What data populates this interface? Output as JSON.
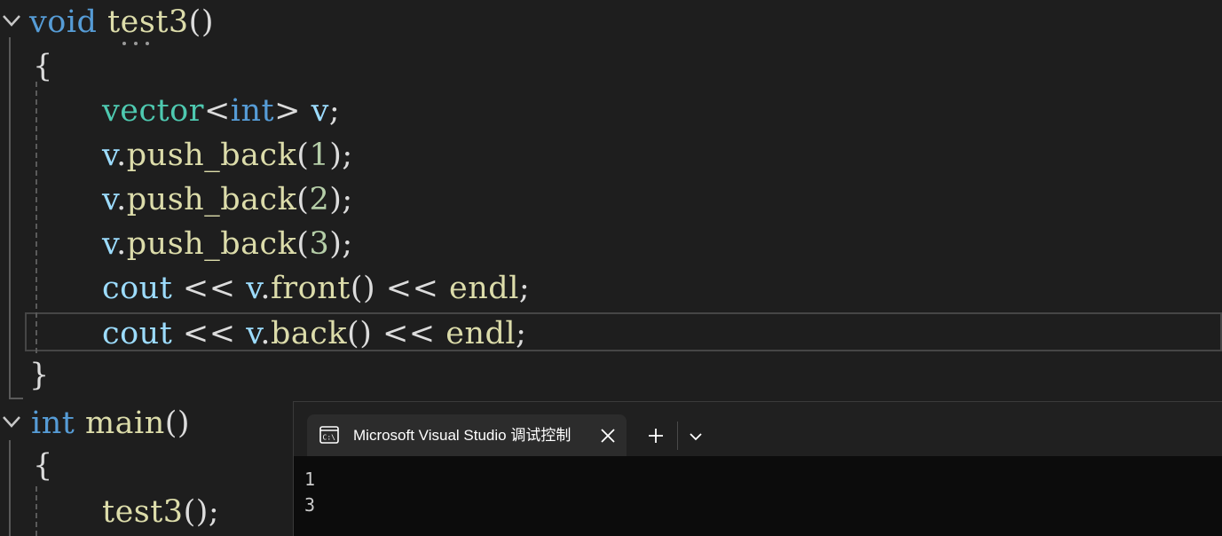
{
  "editor": {
    "lines": [
      [
        {
          "t": "void",
          "c": "kw"
        },
        {
          "t": " "
        },
        {
          "t": "test3",
          "c": "fn"
        },
        {
          "t": "()",
          "c": "pun"
        }
      ],
      [
        {
          "t": "{",
          "c": "pun"
        }
      ],
      [],
      [
        {
          "t": "vector",
          "c": "typ"
        },
        {
          "t": "<",
          "c": "pun"
        },
        {
          "t": "int",
          "c": "kw"
        },
        {
          "t": "> ",
          "c": "pun"
        },
        {
          "t": "v",
          "c": "var"
        },
        {
          "t": ";",
          "c": "pun"
        }
      ],
      [
        {
          "t": "v",
          "c": "var"
        },
        {
          "t": ".",
          "c": "pun"
        },
        {
          "t": "push_back",
          "c": "fn"
        },
        {
          "t": "(",
          "c": "pun"
        },
        {
          "t": "1",
          "c": "num"
        },
        {
          "t": ");",
          "c": "pun"
        }
      ],
      [
        {
          "t": "v",
          "c": "var"
        },
        {
          "t": ".",
          "c": "pun"
        },
        {
          "t": "push_back",
          "c": "fn"
        },
        {
          "t": "(",
          "c": "pun"
        },
        {
          "t": "2",
          "c": "num"
        },
        {
          "t": ");",
          "c": "pun"
        }
      ],
      [
        {
          "t": "v",
          "c": "var"
        },
        {
          "t": ".",
          "c": "pun"
        },
        {
          "t": "push_back",
          "c": "fn"
        },
        {
          "t": "(",
          "c": "pun"
        },
        {
          "t": "3",
          "c": "num"
        },
        {
          "t": ");",
          "c": "pun"
        }
      ],
      [
        {
          "t": "cout",
          "c": "var"
        },
        {
          "t": " << ",
          "c": "pun"
        },
        {
          "t": "v",
          "c": "var"
        },
        {
          "t": ".",
          "c": "pun"
        },
        {
          "t": "front",
          "c": "fn"
        },
        {
          "t": "() << ",
          "c": "pun"
        },
        {
          "t": "endl",
          "c": "fn"
        },
        {
          "t": ";",
          "c": "pun"
        }
      ],
      [
        {
          "t": "cout",
          "c": "var"
        },
        {
          "t": " << ",
          "c": "pun"
        },
        {
          "t": "v",
          "c": "var"
        },
        {
          "t": ".",
          "c": "pun"
        },
        {
          "t": "back",
          "c": "fn"
        },
        {
          "t": "() << ",
          "c": "pun"
        },
        {
          "t": "endl",
          "c": "fn"
        },
        {
          "t": ";",
          "c": "pun"
        }
      ],
      [
        {
          "t": "}",
          "c": "pun"
        }
      ],
      [
        {
          "t": "int",
          "c": "kw"
        },
        {
          "t": " "
        },
        {
          "t": "main",
          "c": "fn"
        },
        {
          "t": "()",
          "c": "pun"
        }
      ],
      [
        {
          "t": "{",
          "c": "pun"
        }
      ],
      [
        {
          "t": "test3",
          "c": "fn"
        },
        {
          "t": "();",
          "c": "pun"
        }
      ]
    ]
  },
  "terminal": {
    "tab_title": "Microsoft Visual Studio 调试控制台",
    "output": [
      "1",
      "3"
    ]
  },
  "colors": {
    "background": "#1e1e1e",
    "keyword": "#569cd6",
    "type": "#4ec9b0",
    "function": "#dcdcaa",
    "variable": "#9cdcfe",
    "number": "#b5cea8",
    "terminal_bg": "#0c0c0c"
  },
  "icons": [
    "chevron-down-icon",
    "console-icon",
    "close-icon",
    "plus-icon"
  ]
}
